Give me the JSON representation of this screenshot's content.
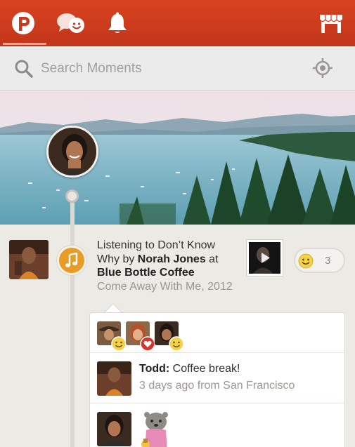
{
  "topbar": {
    "tabs": [
      {
        "name": "path-logo",
        "active": true
      },
      {
        "name": "chat-smiley-icon"
      },
      {
        "name": "bell-icon"
      }
    ],
    "store_icon": "store-icon",
    "accent": "#c9391b"
  },
  "search": {
    "placeholder": "Search Moments",
    "search_icon": "search-icon",
    "locate_icon": "crosshair-icon"
  },
  "moment": {
    "line1": "Listening to Don’t Know",
    "line2_prefix": "Why by ",
    "artist": "Norah Jones",
    "line2_suffix": " at",
    "place": "Blue Bottle Coffee",
    "subtitle": "Come Away With Me, 2012",
    "type_icon": "music-note-icon",
    "badge_color": "#e89c25",
    "reaction_count": "3"
  },
  "card": {
    "reactions": [
      {
        "avatar": "avatar-cowboy",
        "emotion": "smile-emoji"
      },
      {
        "avatar": "avatar-redhead",
        "emotion": "heart-emoji"
      },
      {
        "avatar": "avatar-woman",
        "emotion": "smile-emoji"
      }
    ],
    "comment": {
      "author": "Todd:",
      "text": " Coffee break!",
      "meta": "3 days ago from San Francisco"
    },
    "sticker_comment": {
      "sticker": "otter-sticker"
    }
  }
}
